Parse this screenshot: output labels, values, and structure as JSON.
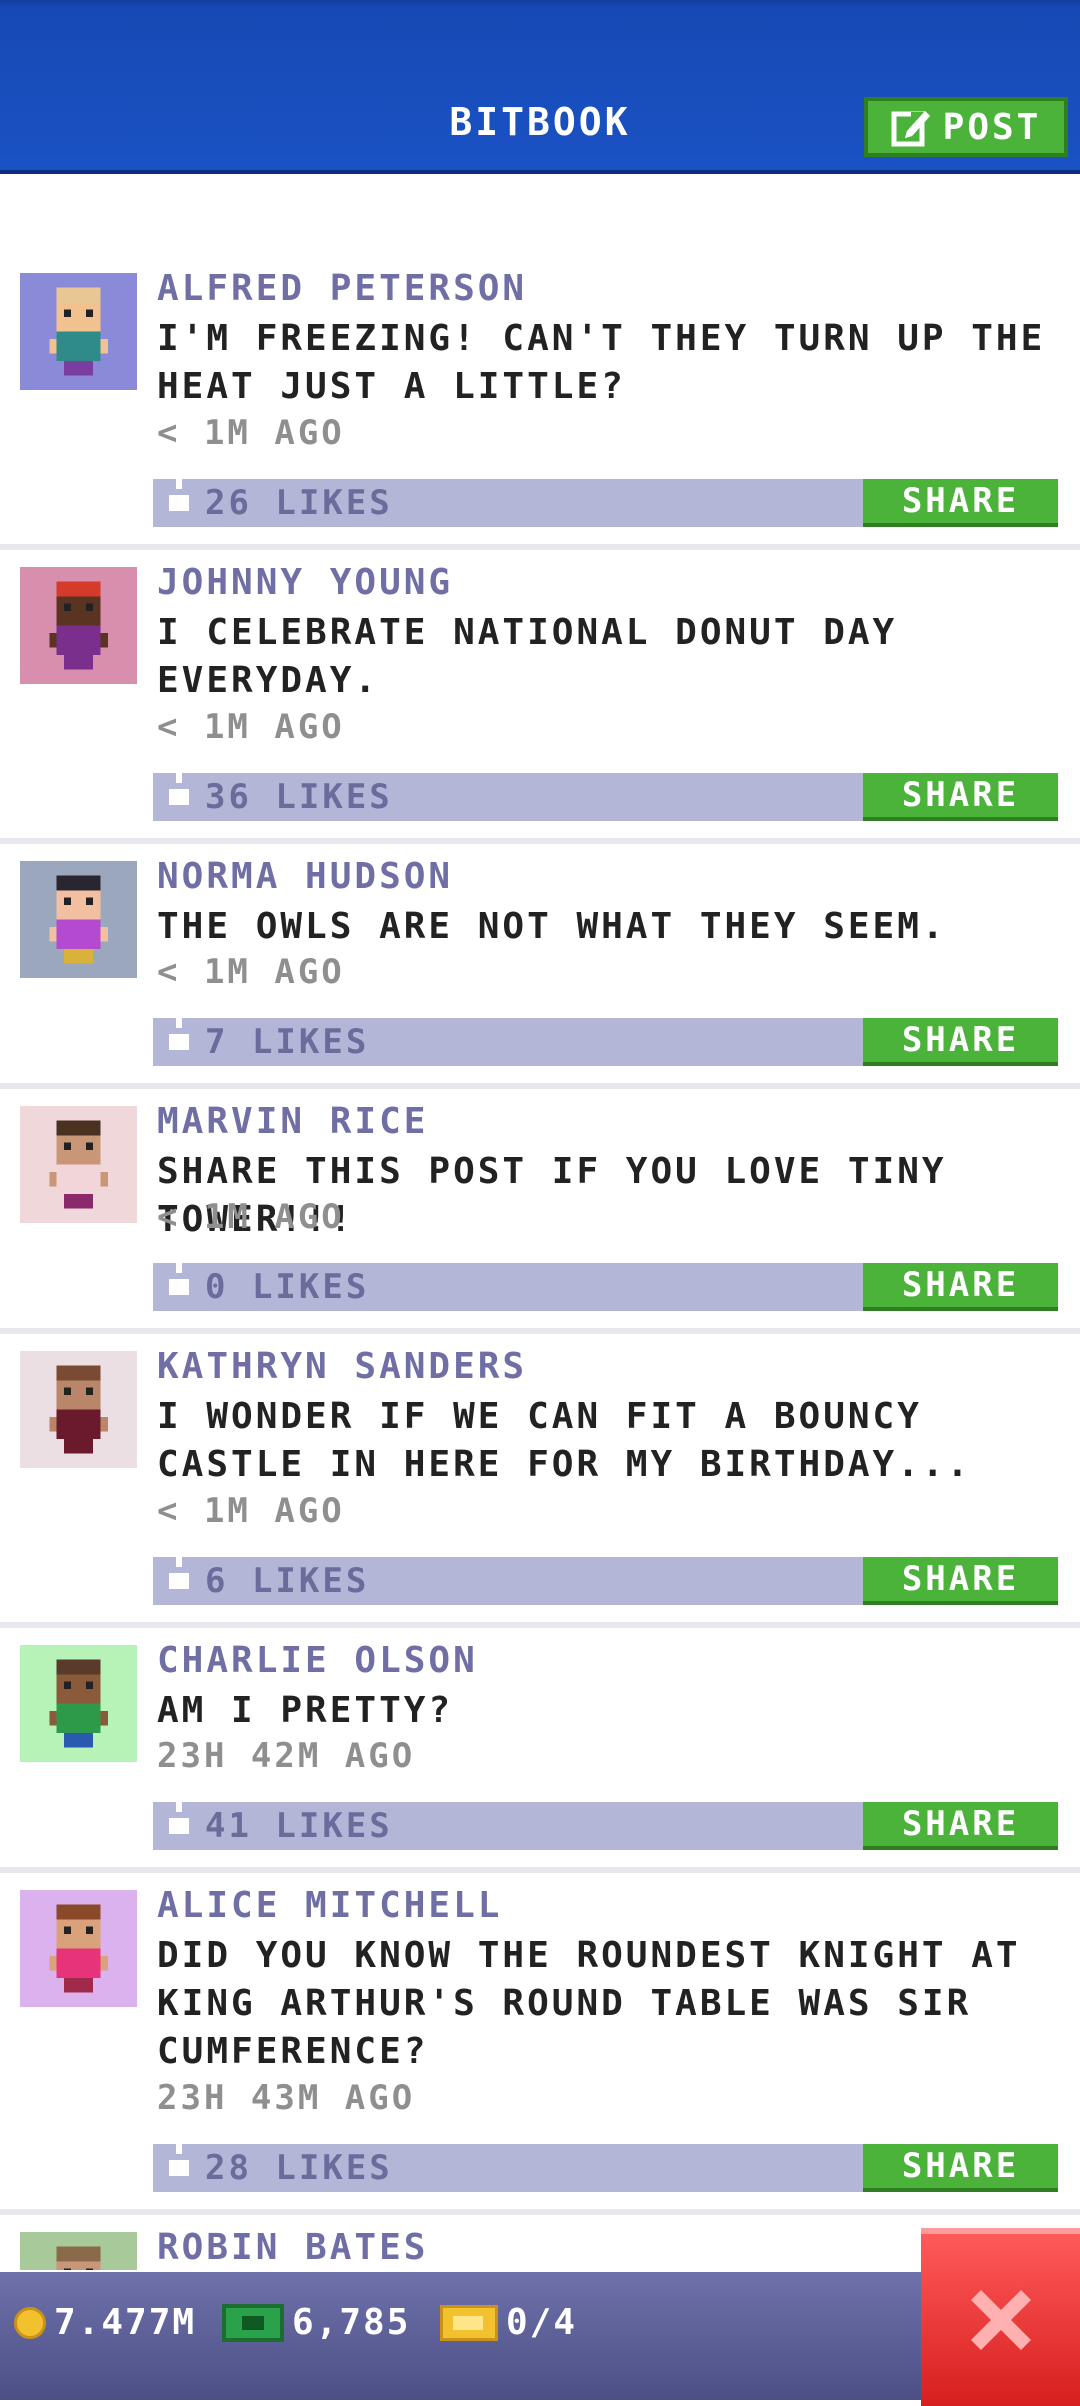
{
  "header": {
    "title": "BITBOOK",
    "post_label": "POST"
  },
  "feed": {
    "share_label": "SHARE",
    "posts": [
      {
        "name": "ALFRED PETERSON",
        "text": "I'M FREEZING! CAN'T THEY TURN UP THE HEAT JUST A LITTLE?",
        "time": "< 1M AGO",
        "likes": "26 LIKES",
        "avatar": {
          "bg": "#8b8ad8",
          "skin": "#f1c28f",
          "hair": "#e8c795",
          "shirt": "#2f8b8a",
          "pants": "#7a3da0"
        }
      },
      {
        "name": "JOHNNY YOUNG",
        "text": "I CELEBRATE NATIONAL DONUT DAY EVERYDAY.",
        "time": "< 1M AGO",
        "likes": "36 LIKES",
        "avatar": {
          "bg": "#d88fad",
          "skin": "#5a3323",
          "hair": "#d63a2a",
          "shirt": "#7a2f8c",
          "pants": "#7a2f8c"
        }
      },
      {
        "name": "NORMA HUDSON",
        "text": "THE OWLS ARE NOT WHAT THEY SEEM.",
        "time": "< 1M AGO",
        "likes": "7 LIKES",
        "avatar": {
          "bg": "#9ba7bd",
          "skin": "#f2c0a0",
          "hair": "#2a2630",
          "shirt": "#b34ad0",
          "pants": "#d9b23a"
        }
      },
      {
        "name": "MARVIN RICE",
        "text": "SHARE THIS POST IF YOU LOVE TINY TOWER!!!",
        "time": "< 1M AGO",
        "likes": "0 LIKES",
        "avatar": {
          "bg": "#f0d7da",
          "skin": "#c99777",
          "hair": "#4a3220",
          "shirt": "#f2d5d8",
          "pants": "#8a2a6a"
        }
      },
      {
        "name": "KATHRYN SANDERS",
        "text": "I WONDER IF WE CAN FIT A BOUNCY CASTLE IN HERE FOR MY BIRTHDAY...",
        "time": "< 1M AGO",
        "likes": "6 LIKES",
        "avatar": {
          "bg": "#ecdfe3",
          "skin": "#b9866a",
          "hair": "#7a4a32",
          "shirt": "#6a1a2a",
          "pants": "#6a1a2a"
        }
      },
      {
        "name": "CHARLIE OLSON",
        "text": "AM I PRETTY?",
        "time": "23H 42M AGO",
        "likes": "41 LIKES",
        "avatar": {
          "bg": "#b7f2b6",
          "skin": "#8b5a3a",
          "hair": "#5a3a2a",
          "shirt": "#2c9a49",
          "pants": "#2a59b0"
        }
      },
      {
        "name": "ALICE MITCHELL",
        "text": "DID YOU KNOW THE ROUNDEST KNIGHT AT KING ARTHUR'S ROUND TABLE WAS SIR CUMFERENCE?",
        "time": "23H 43M AGO",
        "likes": "28 LIKES",
        "avatar": {
          "bg": "#dcb2ee",
          "skin": "#d9a27a",
          "hair": "#8a4a2a",
          "shirt": "#e6337a",
          "pants": "#a02a4a"
        }
      },
      {
        "name": "ROBIN BATES",
        "text": "",
        "time": "",
        "likes": "",
        "avatar": {
          "bg": "#a8c99a",
          "skin": "#c99777",
          "hair": "#8a6a4a",
          "shirt": "#c99777",
          "pants": "#c99777"
        }
      }
    ]
  },
  "status": {
    "coins": "7.477M",
    "bux": "6,785",
    "tickets": "0/4"
  }
}
